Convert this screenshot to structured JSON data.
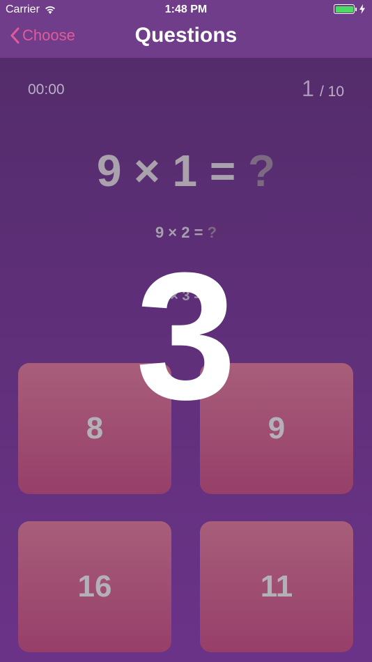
{
  "status_bar": {
    "carrier": "Carrier",
    "time": "1:48 PM"
  },
  "nav": {
    "back_label": "Choose",
    "title": "Questions"
  },
  "quiz": {
    "timer": "00:00",
    "current_question": "1",
    "total_questions": "/ 10",
    "main_question": "9 × 1 = ",
    "main_question_mark": "?",
    "next_question": "9 × 2 = ",
    "next_question_mark": "?",
    "third_question": "× 3 =",
    "countdown": "3"
  },
  "answers": [
    "8",
    "9",
    "16",
    "11"
  ],
  "colors": {
    "accent": "#e35a9a",
    "background": "#6a3787",
    "answer_button": "#a85e7a"
  }
}
